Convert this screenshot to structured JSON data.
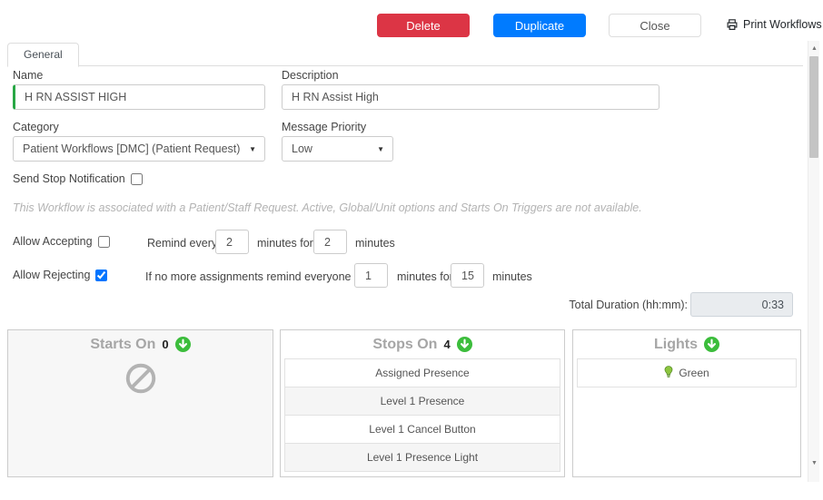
{
  "toolbar": {
    "delete": "Delete",
    "duplicate": "Duplicate",
    "close": "Close",
    "print": "Print Workflows"
  },
  "tab": {
    "general": "General"
  },
  "form": {
    "name_label": "Name",
    "name_value": "H RN ASSIST HIGH",
    "description_label": "Description",
    "description_value": "H RN Assist High",
    "category_label": "Category",
    "category_value": "Patient Workflows [DMC] (Patient Request)",
    "priority_label": "Message Priority",
    "priority_value": "Low",
    "send_stop_label": "Send Stop Notification",
    "send_stop_checked": false,
    "notice": "This Workflow is associated with a Patient/Staff Request. Active, Global/Unit options and Starts On Triggers are not available.",
    "accepting": {
      "label": "Allow Accepting",
      "checked": false,
      "text1": "Remind every",
      "every": "2",
      "text2": "minutes for",
      "for": "2",
      "text3": "minutes"
    },
    "rejecting": {
      "label": "Allow Rejecting",
      "checked": true,
      "text1": "If no more assignments remind everyone every",
      "every": "1",
      "text2": "minutes for",
      "for": "15",
      "text3": "minutes"
    },
    "total_duration_label": "Total Duration (hh:mm):",
    "total_duration_value": "0:33"
  },
  "panels": {
    "starts_on": {
      "title": "Starts On",
      "count": "0"
    },
    "stops_on": {
      "title": "Stops On",
      "count": "4",
      "items": [
        "Assigned Presence",
        "Level 1 Presence",
        "Level 1 Cancel Button",
        "Level 1 Presence Light"
      ]
    },
    "lights": {
      "title": "Lights",
      "items": [
        "Green"
      ]
    }
  },
  "colors": {
    "delete_red": "#dc3545",
    "duplicate_blue": "#007bff",
    "accent_green": "#28a745",
    "icon_green": "#3cbd3c",
    "light_green": "#8dc63f"
  }
}
